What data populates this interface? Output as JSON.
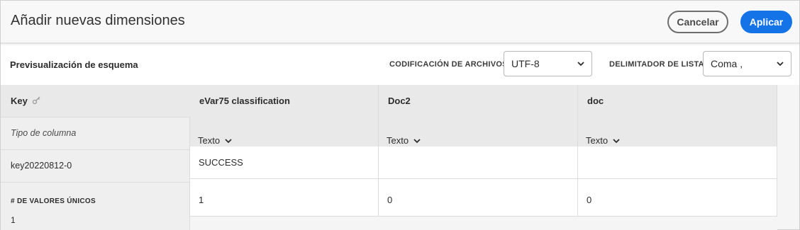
{
  "dialog": {
    "title": "Añadir nuevas dimensiones",
    "cancel_label": "Cancelar",
    "apply_label": "Aplicar",
    "accent_color": "#1473e6"
  },
  "toolbar": {
    "schema_label": "Previsualización de esquema",
    "encoding_label": "CODIFICACIÓN DE ARCHIVOS",
    "encoding_value": "UTF-8",
    "delimiter_label": "DELIMITADOR DE LISTA",
    "delimiter_value": "Coma ,"
  },
  "schema": {
    "key_header": "Key",
    "row_labels": {
      "column_type": "Tipo de columna",
      "key_value": "key20220812-0",
      "unique_label": "# DE VALORES ÚNICOS",
      "unique_value": "1"
    },
    "columns": [
      {
        "header": "eVar75 classification",
        "type": "Texto",
        "value": "SUCCESS",
        "unique": "1"
      },
      {
        "header": "Doc2",
        "type": "Texto",
        "value": "",
        "unique": "0"
      },
      {
        "header": "doc",
        "type": "Texto",
        "value": "",
        "unique": "0"
      }
    ],
    "icons": {
      "key": "key-icon",
      "type_dropdown": "chevron-down-icon"
    }
  }
}
